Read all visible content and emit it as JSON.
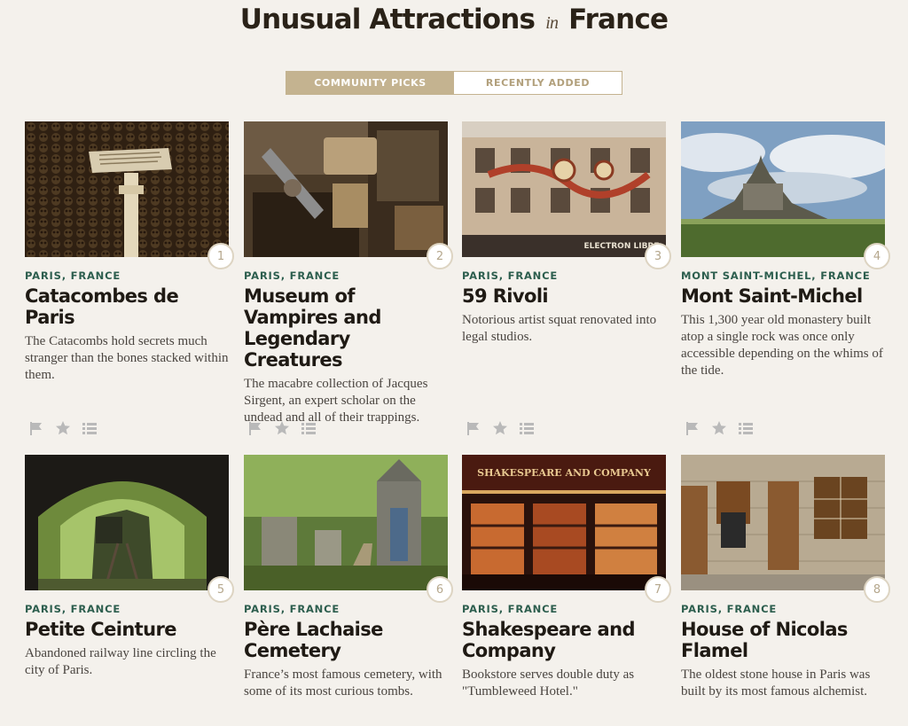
{
  "page": {
    "title_main": "Unusual Attractions",
    "title_in": "in",
    "title_place": "France"
  },
  "tabs": [
    {
      "label": "COMMUNITY PICKS",
      "active": true
    },
    {
      "label": "RECENTLY ADDED",
      "active": false
    }
  ],
  "places": [
    {
      "rank": "1",
      "location": "PARIS, FRANCE",
      "name": "Catacombes de Paris",
      "description": "The Catacombs hold secrets much stranger than the bones stacked within them."
    },
    {
      "rank": "2",
      "location": "PARIS, FRANCE",
      "name": "Museum of Vampires and Legendary Creatures",
      "description": "The macabre collection of Jacques Sirgent, an expert scholar on the undead and all of their trappings."
    },
    {
      "rank": "3",
      "location": "PARIS, FRANCE",
      "name": "59 Rivoli",
      "description": "Notorious artist squat renovated into legal studios."
    },
    {
      "rank": "4",
      "location": "MONT SAINT-MICHEL, FRANCE",
      "name": "Mont Saint-Michel",
      "description": "This 1,300 year old monastery built atop a single rock was once only accessible depending on the whims of the tide."
    },
    {
      "rank": "5",
      "location": "PARIS, FRANCE",
      "name": "Petite Ceinture",
      "description": "Abandoned railway line circling the city of Paris."
    },
    {
      "rank": "6",
      "location": "PARIS, FRANCE",
      "name": "Père Lachaise Cemetery",
      "description": "France’s most famous cemetery, with some of its most curious tombs."
    },
    {
      "rank": "7",
      "location": "PARIS, FRANCE",
      "name": "Shakespeare and Company",
      "description": "Bookstore serves double duty as \"Tumbleweed Hotel.\""
    },
    {
      "rank": "8",
      "location": "PARIS, FRANCE",
      "name": "House of Nicolas Flamel",
      "description": "The oldest stone house in Paris was built by its most famous alchemist."
    }
  ],
  "photo_labels": {
    "rivoli_sign": "ELECTRON LIBRE",
    "shakespeare_sign": "SHAKESPEARE AND COMPANY"
  },
  "colors": {
    "background": "#f4f1ec",
    "accent": "#c4b390",
    "location_green": "#2d5e4e",
    "icon_gray": "#b9b9b9"
  },
  "icons": [
    "flag-icon",
    "star-icon",
    "list-icon"
  ]
}
